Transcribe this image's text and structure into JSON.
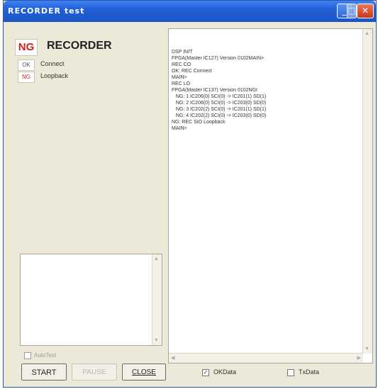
{
  "window": {
    "title": "RECORDER test",
    "min_glyph": "_",
    "max_glyph": "□",
    "close_glyph": "✕"
  },
  "summary": {
    "status_badge": "NG",
    "title": "RECORDER",
    "items": [
      {
        "status": "OK",
        "label": "Connect"
      },
      {
        "status": "NG",
        "label": "Loopback"
      }
    ]
  },
  "autotest_label": "AutoTest",
  "buttons": {
    "start": "START",
    "pause": "PAUSE",
    "close": "CLOSE"
  },
  "log": {
    "lines": [
      "DSP INIT",
      "FPGA(Master IC127) Version 0102MAIN>",
      "REC CO",
      "OK: REC Connect",
      "MAIN>",
      "REC LO",
      "FPGA(Master IC137) Version 0102NGI",
      "   NG: 1 IC206(0) SCI(0) -> IC201(1) SD(1)",
      "   NG: 2 IC206(0) SCI(0) -> IC203(0) SD(0)",
      "   NG: 3 IC202(2) SCI(0) -> IC201(1) SD(1)",
      "   NG: 4 IC202(2) SCI(0) -> IC203(0) SD(0)",
      "NG: REC SIO Loopback",
      "MAIN>"
    ]
  },
  "options": {
    "okdata_label": "OKData",
    "okdata_checked": true,
    "okdata_mark": "✓",
    "txdata_label": "TxData",
    "txdata_checked": false
  },
  "colors": {
    "titlebar": "#2160d8",
    "ng_red": "#d22020",
    "window_bg": "#ece9d8"
  }
}
